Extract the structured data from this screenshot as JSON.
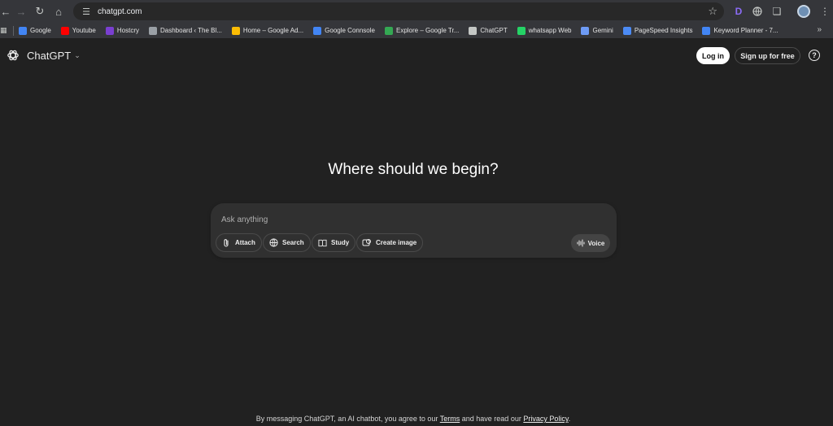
{
  "browser": {
    "url": "chatgpt.com",
    "bookmarks": [
      {
        "label": "Google",
        "icon": "google-icon",
        "color": "#4285f4"
      },
      {
        "label": "Youtube",
        "icon": "youtube-icon",
        "color": "#ff0000"
      },
      {
        "label": "Hostcry",
        "icon": "hostcry-icon",
        "color": "#7a3fd1"
      },
      {
        "label": "Dashboard ‹ The Bl...",
        "icon": "dashboard-icon",
        "color": "#9aa0a6"
      },
      {
        "label": "Home – Google Ad...",
        "icon": "google-ads-icon",
        "color": "#fbbc04"
      },
      {
        "label": "Google Connsole",
        "icon": "search-console-icon",
        "color": "#4285f4"
      },
      {
        "label": "Explore – Google Tr...",
        "icon": "google-trends-icon",
        "color": "#34a853"
      },
      {
        "label": "ChatGPT",
        "icon": "chatgpt-icon",
        "color": "#c4c7c5"
      },
      {
        "label": "whatsapp Web",
        "icon": "whatsapp-icon",
        "color": "#25d366"
      },
      {
        "label": "Gemini",
        "icon": "gemini-icon",
        "color": "#6e9bf5"
      },
      {
        "label": "PageSpeed Insights",
        "icon": "pagespeed-icon",
        "color": "#4c8bf5"
      },
      {
        "label": "Keyword Planner - 7...",
        "icon": "keyword-planner-icon",
        "color": "#4285f4"
      }
    ]
  },
  "header": {
    "brand": "ChatGPT",
    "login_label": "Log in",
    "signup_label": "Sign up for free",
    "help_label": "?"
  },
  "main": {
    "headline": "Where should we begin?",
    "composer": {
      "placeholder": "Ask anything",
      "tools": [
        {
          "label": "Attach",
          "icon": "paperclip-icon"
        },
        {
          "label": "Search",
          "icon": "globe-icon"
        },
        {
          "label": "Study",
          "icon": "book-icon"
        },
        {
          "label": "Create image",
          "icon": "image-icon"
        }
      ],
      "voice_label": "Voice"
    }
  },
  "footer": {
    "prefix": "By messaging ChatGPT, an AI chatbot, you agree to our",
    "terms": "Terms",
    "middle": "and have read our",
    "privacy": "Privacy Policy",
    "suffix": "."
  }
}
